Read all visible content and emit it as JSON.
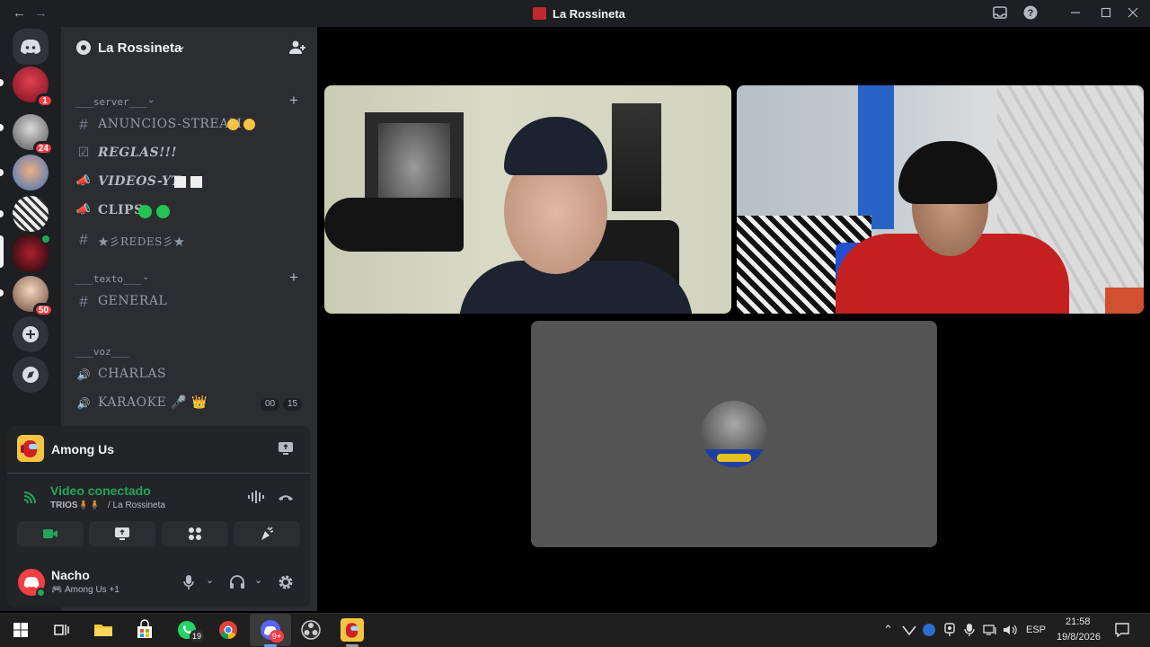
{
  "window": {
    "title": "La Rossineta",
    "nav_back": "←",
    "nav_forward": "→",
    "inbox_icon": "inbox-icon",
    "help_icon": "help-icon"
  },
  "rail": {
    "home_icon": "discord-home-icon",
    "servers": [
      {
        "badge": "1"
      },
      {
        "badge": "24"
      },
      {
        "badge": ""
      },
      {
        "badge": ""
      },
      {
        "badge": ""
      },
      {
        "badge": "50"
      }
    ]
  },
  "server": {
    "name": "La Rossineta",
    "invite_icon": "add-member-icon"
  },
  "categories": {
    "server": "___server___",
    "texto": "___texto___",
    "voz": "___voz___"
  },
  "channels": [
    {
      "icon": "#",
      "name": "ANUNCIOS-STREAM"
    },
    {
      "icon": "☑",
      "name": "REGLAS!!!"
    },
    {
      "icon": "📣",
      "name": "VIDEOS-YT"
    },
    {
      "icon": "📣",
      "name": "CLIPS"
    },
    {
      "icon": "#",
      "name": "★彡REDES彡★"
    },
    {
      "icon": "#",
      "name": "GENERAL"
    },
    {
      "icon": "🔊",
      "name": "CHARLAS"
    },
    {
      "icon": "🔊",
      "name": "KARAOKE 🎤 👑"
    }
  ],
  "karaoke_counts": {
    "a": "00",
    "b": "15"
  },
  "activity": {
    "game": "Among Us"
  },
  "voice": {
    "status": "Video conectado",
    "location_channel": "TRIOS🧍🧍",
    "location_server": "/ La Rossineta"
  },
  "user": {
    "name": "Nacho",
    "activity": "Among Us +1"
  },
  "taskbar": {
    "lang": "ESP",
    "time": "21:58",
    "date": "19/8/2026",
    "whatsapp_badge": "19",
    "discord_badge": "9+"
  },
  "colors": {
    "discord_bg": "#2b2d31",
    "rail_bg": "#1e1f22",
    "green": "#23a55a",
    "red_badge": "#f23f43",
    "blurple": "#5865f2"
  }
}
